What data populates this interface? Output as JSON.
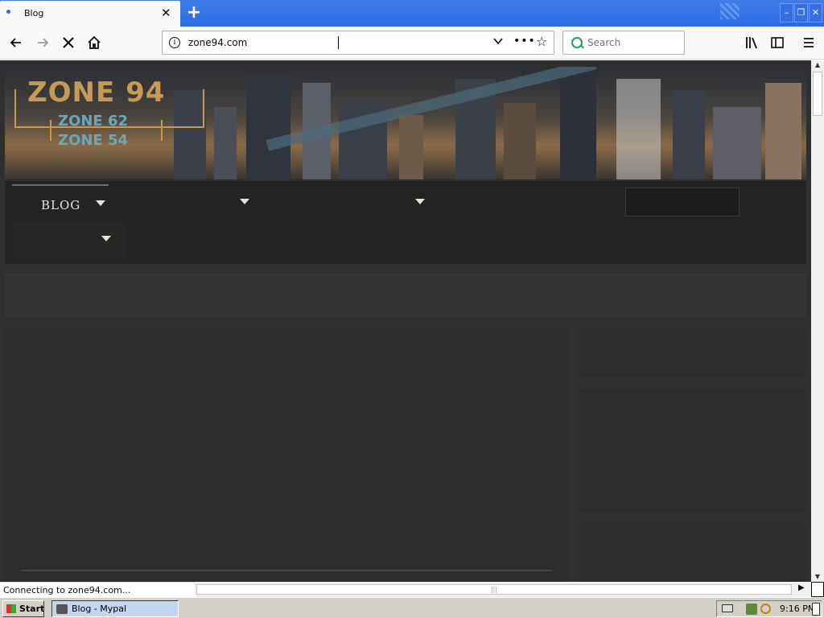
{
  "browser": {
    "tab": {
      "title": "Blog",
      "close": "✕"
    },
    "new_tab": "+",
    "window_controls": {
      "minimize": "–",
      "restore": "❐",
      "close": "✕"
    },
    "url": "zone94.com",
    "search_placeholder": "Search",
    "status": "Connecting to zone94.com...",
    "icons": [
      "back-icon",
      "forward-icon",
      "stop-icon",
      "home-icon",
      "info-icon",
      "dropdown-icon",
      "page-actions-icon",
      "bookmark-star-icon",
      "search-icon",
      "library-icon",
      "sidebar-icon",
      "menu-icon"
    ]
  },
  "site": {
    "logo_main": "ZONE 94",
    "logo_sub": [
      "ZONE 62",
      "ZONE 54"
    ],
    "menu": {
      "blog": "BLOG"
    }
  },
  "taskbar": {
    "start": "Start",
    "item": "Blog - Mypal",
    "clock": "9:16 PM"
  },
  "colors": {
    "accent": "#2a6be3",
    "logo_gold": "#c49a55",
    "logo_teal": "#6ea6b9",
    "page_bg": "#2f2f2f"
  }
}
